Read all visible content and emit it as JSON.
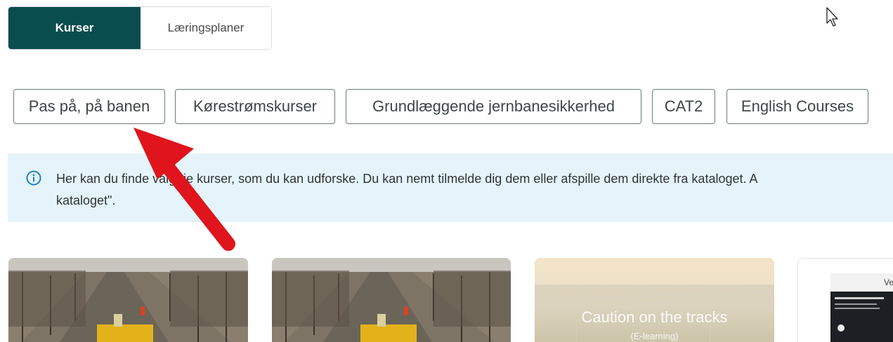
{
  "tabs": [
    {
      "label": "Kurser",
      "active": true
    },
    {
      "label": "Læringsplaner",
      "active": false
    }
  ],
  "chips": [
    {
      "label": "Pas på, på banen"
    },
    {
      "label": "Kørestrømskurser"
    },
    {
      "label": "Grundlæggende jernbanesikkerhed"
    },
    {
      "label": "CAT2"
    },
    {
      "label": "English Courses"
    }
  ],
  "info": {
    "icon": "info-icon",
    "line1": "Her kan du finde valgfrie kurser, som du kan udforske. Du kan nemt tilmelde dig dem eller afspille dem direkte fra kataloget. A",
    "line2": "kataloget\"."
  },
  "cards": [
    {
      "title": ""
    },
    {
      "title": ""
    },
    {
      "title": "Caution on the tracks",
      "subtitle": "(E-learning)"
    },
    {
      "title": "Velko"
    }
  ],
  "colors": {
    "accent": "#0a4d4f",
    "info_bg": "#e5f4fa",
    "annotation_arrow": "#e0141c"
  }
}
